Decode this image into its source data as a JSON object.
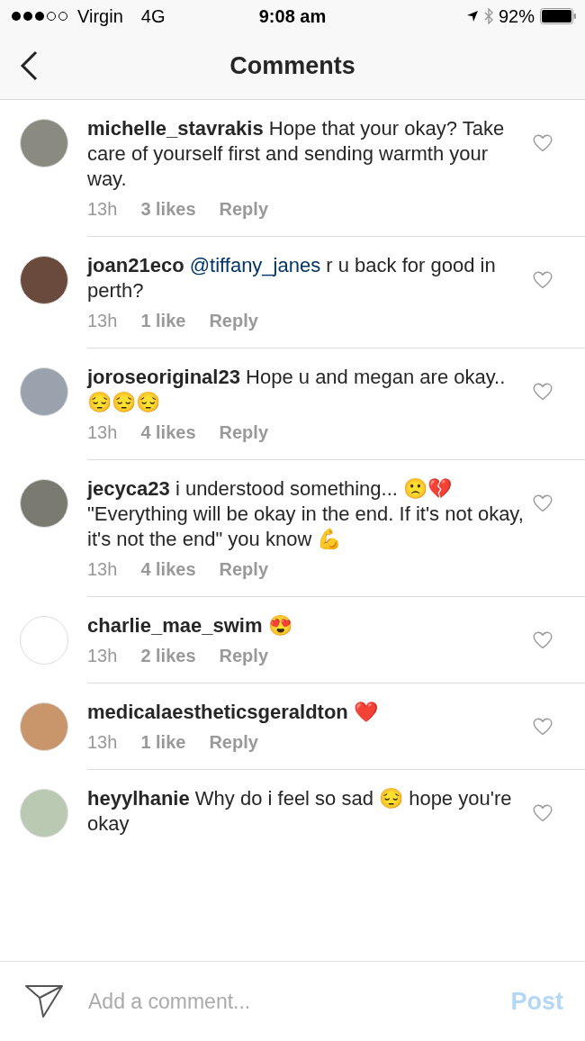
{
  "status_bar": {
    "carrier": "Virgin",
    "network": "4G",
    "time": "9:08 am",
    "battery": "92%"
  },
  "nav": {
    "title": "Comments"
  },
  "comments": [
    {
      "username": "michelle_stavrakis",
      "text": "Hope that your okay? Take care of yourself first and sending warmth your way.",
      "time": "13h",
      "likes": "3 likes",
      "reply": "Reply",
      "liked": false
    },
    {
      "username": "joan21eco",
      "mention": "@tiffany_janes",
      "text": "r u back for good in perth?",
      "time": "13h",
      "likes": "1 like",
      "reply": "Reply",
      "liked": false
    },
    {
      "username": "joroseoriginal23",
      "text": "Hope u and megan are okay.. 😔😔😔",
      "time": "13h",
      "likes": "4 likes",
      "reply": "Reply",
      "liked": false
    },
    {
      "username": "jecyca23",
      "text": "i understood something... 🙁💔  \"Everything will be okay in the end. If it's not okay, it's not the end\" you know 💪",
      "time": "13h",
      "likes": "4 likes",
      "reply": "Reply",
      "liked": false
    },
    {
      "username": "charlie_mae_swim",
      "text": "😍",
      "time": "13h",
      "likes": "2 likes",
      "reply": "Reply",
      "liked": false
    },
    {
      "username": "medicalaestheticsgeraldton",
      "text": "❤️",
      "time": "13h",
      "likes": "1 like",
      "reply": "Reply",
      "liked": false
    },
    {
      "username": "heyylhanie",
      "text": "Why do i feel so sad 😔 hope you're okay",
      "liked": false
    }
  ],
  "composer": {
    "placeholder": "Add a comment...",
    "post": "Post"
  }
}
